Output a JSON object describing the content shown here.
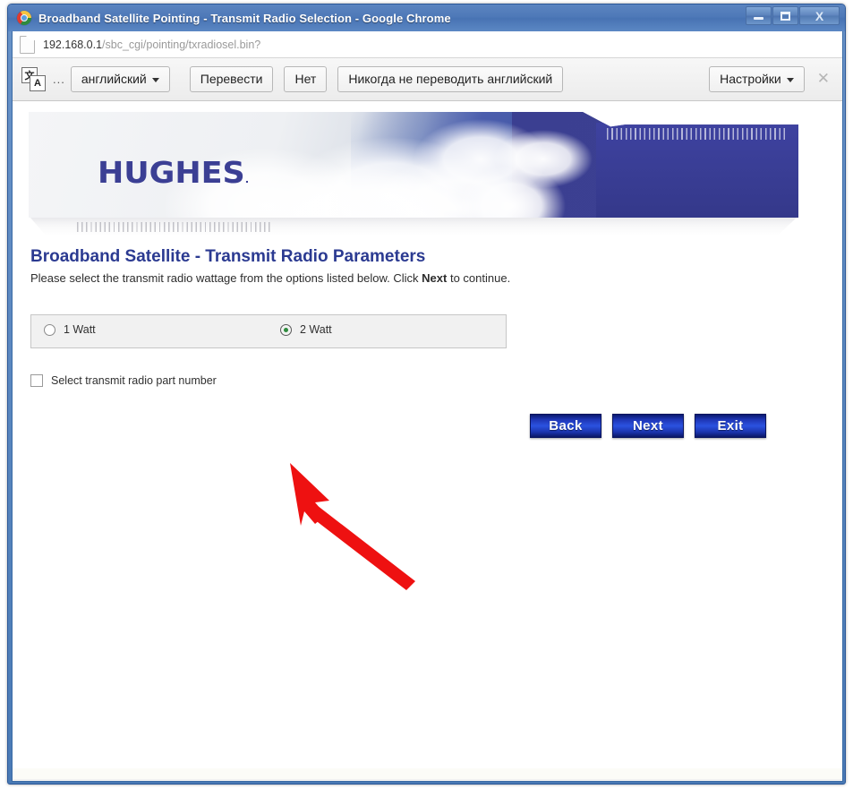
{
  "window": {
    "title": "Broadband Satellite Pointing - Transmit Radio Selection - Google Chrome",
    "minimize_label": "Minimize",
    "maximize_label": "Maximize",
    "close_label": "X"
  },
  "address_bar": {
    "url_host": "192.168.0.1",
    "url_path": "/sbc_cgi/pointing/txradiosel.bin?"
  },
  "translate_bar": {
    "icon_letter_top": "文",
    "icon_letter_bottom": "A",
    "dots": "...",
    "language": "английский",
    "translate_button": "Перевести",
    "no_button": "Нет",
    "never_translate_button": "Никогда не переводить английский",
    "settings_button": "Настройки",
    "close_label": "✕"
  },
  "banner": {
    "logo_text": "HUGHES",
    "logo_trademark": "."
  },
  "page": {
    "title": "Broadband Satellite - Transmit Radio Parameters",
    "subtitle_before": "Please select the transmit radio wattage from the options listed below. Click ",
    "subtitle_bold": "Next",
    "subtitle_after": " to continue.",
    "radio_options": [
      {
        "label": "1 Watt",
        "selected": false
      },
      {
        "label": "2 Watt",
        "selected": true
      }
    ],
    "checkbox": {
      "label": "Select transmit radio part number",
      "checked": false
    },
    "buttons": [
      {
        "label": "Back"
      },
      {
        "label": "Next"
      },
      {
        "label": "Exit"
      }
    ]
  },
  "annotation": {
    "arrow_color": "#ee1111",
    "points_to": "2 Watt"
  }
}
